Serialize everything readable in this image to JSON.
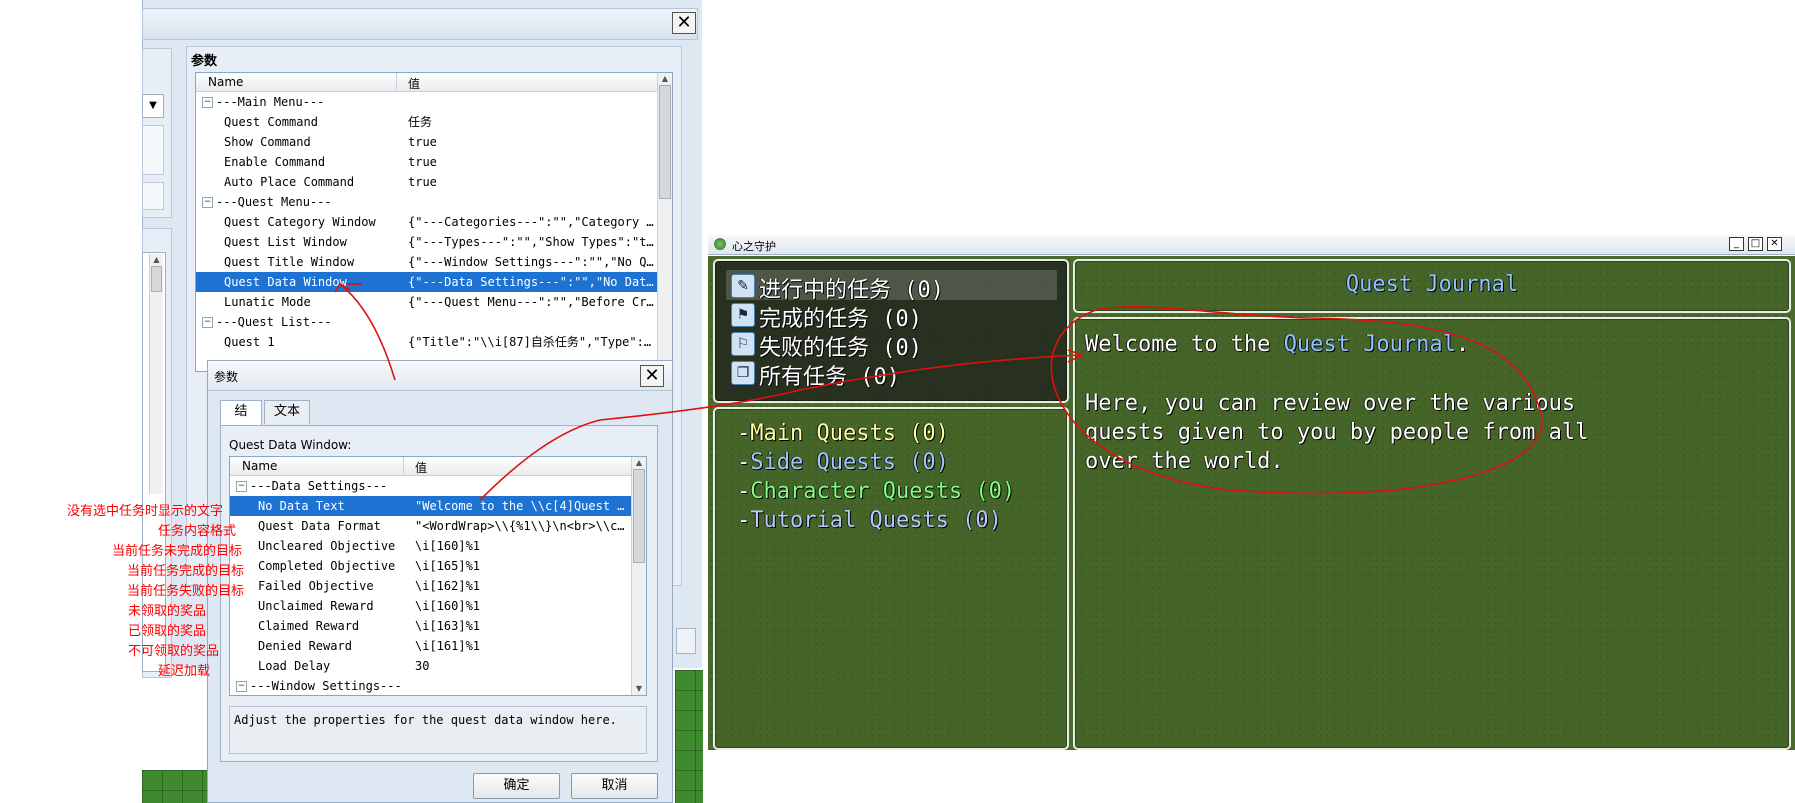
{
  "back_dialog": {
    "params_label": "参数",
    "col_name": "Name",
    "col_value": "值",
    "rows": [
      {
        "type": "group",
        "name": "---Main Menu---",
        "value": ""
      },
      {
        "type": "item",
        "name": "Quest Command",
        "value": "任务"
      },
      {
        "type": "item",
        "name": "Show Command",
        "value": "true"
      },
      {
        "type": "item",
        "name": "Enable Command",
        "value": "true"
      },
      {
        "type": "item",
        "name": "Auto Place Command",
        "value": "true"
      },
      {
        "type": "group",
        "name": "---Quest Menu---",
        "value": ""
      },
      {
        "type": "item",
        "name": "Quest Category Window",
        "value": "{\"---Categories---\":\"\",\"Category O…"
      },
      {
        "type": "item",
        "name": "Quest List Window",
        "value": "{\"---Types---\":\"\",\"Show Types\":\"tr…"
      },
      {
        "type": "item",
        "name": "Quest Title Window",
        "value": "{\"---Window Settings---\":\"\",\"No Qu…"
      },
      {
        "type": "item",
        "name": "Quest Data Window",
        "value": "{\"---Data Settings---\":\"\",\"No Data…",
        "selected": true
      },
      {
        "type": "item",
        "name": "Lunatic Mode",
        "value": "{\"---Quest Menu---\":\"\",\"Before Cre…"
      },
      {
        "type": "group",
        "name": "---Quest List---",
        "value": ""
      },
      {
        "type": "item",
        "name": "Quest 1",
        "value": "{\"Title\":\"\\\\i[87]自杀任务\",\"Type\":…"
      }
    ]
  },
  "front_dialog": {
    "title": "参数",
    "tabs": [
      "结构",
      "文本"
    ],
    "section_label": "Quest Data Window:",
    "col_name": "Name",
    "col_value": "值",
    "rows": [
      {
        "type": "group",
        "name": "---Data Settings---",
        "value": ""
      },
      {
        "type": "item",
        "name": "No Data Text",
        "value": "\"Welcome to the \\\\c[4]Quest J…",
        "selected": true
      },
      {
        "type": "item",
        "name": "Quest Data Format",
        "value": "\"<WordWrap>\\\\{%1\\\\}\\n<br>\\\\c[…"
      },
      {
        "type": "item",
        "name": "Uncleared Objective",
        "value": "\\i[160]%1"
      },
      {
        "type": "item",
        "name": "Completed Objective",
        "value": "\\i[165]%1"
      },
      {
        "type": "item",
        "name": "Failed Objective",
        "value": "\\i[162]%1"
      },
      {
        "type": "item",
        "name": "Unclaimed Reward",
        "value": "\\i[160]%1"
      },
      {
        "type": "item",
        "name": "Claimed Reward",
        "value": "\\i[163]%1"
      },
      {
        "type": "item",
        "name": "Denied Reward",
        "value": "\\i[161]%1"
      },
      {
        "type": "item",
        "name": "Load Delay",
        "value": "30"
      },
      {
        "type": "group",
        "name": "---Window Settings---",
        "value": ""
      }
    ],
    "description": "Adjust the properties for the quest data window here.",
    "ok_label": "确定",
    "cancel_label": "取消"
  },
  "annotations": [
    "没有选中任务时显示的文字",
    "任务内容格式",
    "当前任务未完成的目标",
    "当前任务完成的目标",
    "当前任务失败的目标",
    "未领取的奖品",
    "已领取的奖品",
    "不可领取的奖品",
    "延迟加载"
  ],
  "game": {
    "window_title": "心之守护",
    "categories": [
      {
        "label": "进行中的任务 (0)",
        "icon": "speech-icon"
      },
      {
        "label": "完成的任务 (0)",
        "icon": "flag-icon"
      },
      {
        "label": "失败的任务 (0)",
        "icon": "broken-flag-icon"
      },
      {
        "label": "所有任务 (0)",
        "icon": "book-icon"
      }
    ],
    "quest_types": [
      {
        "prefix": "-",
        "label": "Main Quests (0)",
        "color": "#ffffa0"
      },
      {
        "prefix": "-",
        "label": "Side Quests (0)",
        "color": "#a0c8ff"
      },
      {
        "prefix": "-",
        "label": "Character Quests (0)",
        "color": "#80ff80"
      },
      {
        "prefix": "-",
        "label": "Tutorial Quests (0)",
        "color": "#b8c8ff"
      }
    ],
    "title": "Quest Journal",
    "welcome_prefix": "Welcome to the ",
    "welcome_highlight": "Quest Journal",
    "welcome_suffix": ".",
    "body_lines": [
      "Here, you can review over the various",
      "quests given to you by people from all",
      "over the world."
    ],
    "highlight_color": "#8fc4ff"
  }
}
